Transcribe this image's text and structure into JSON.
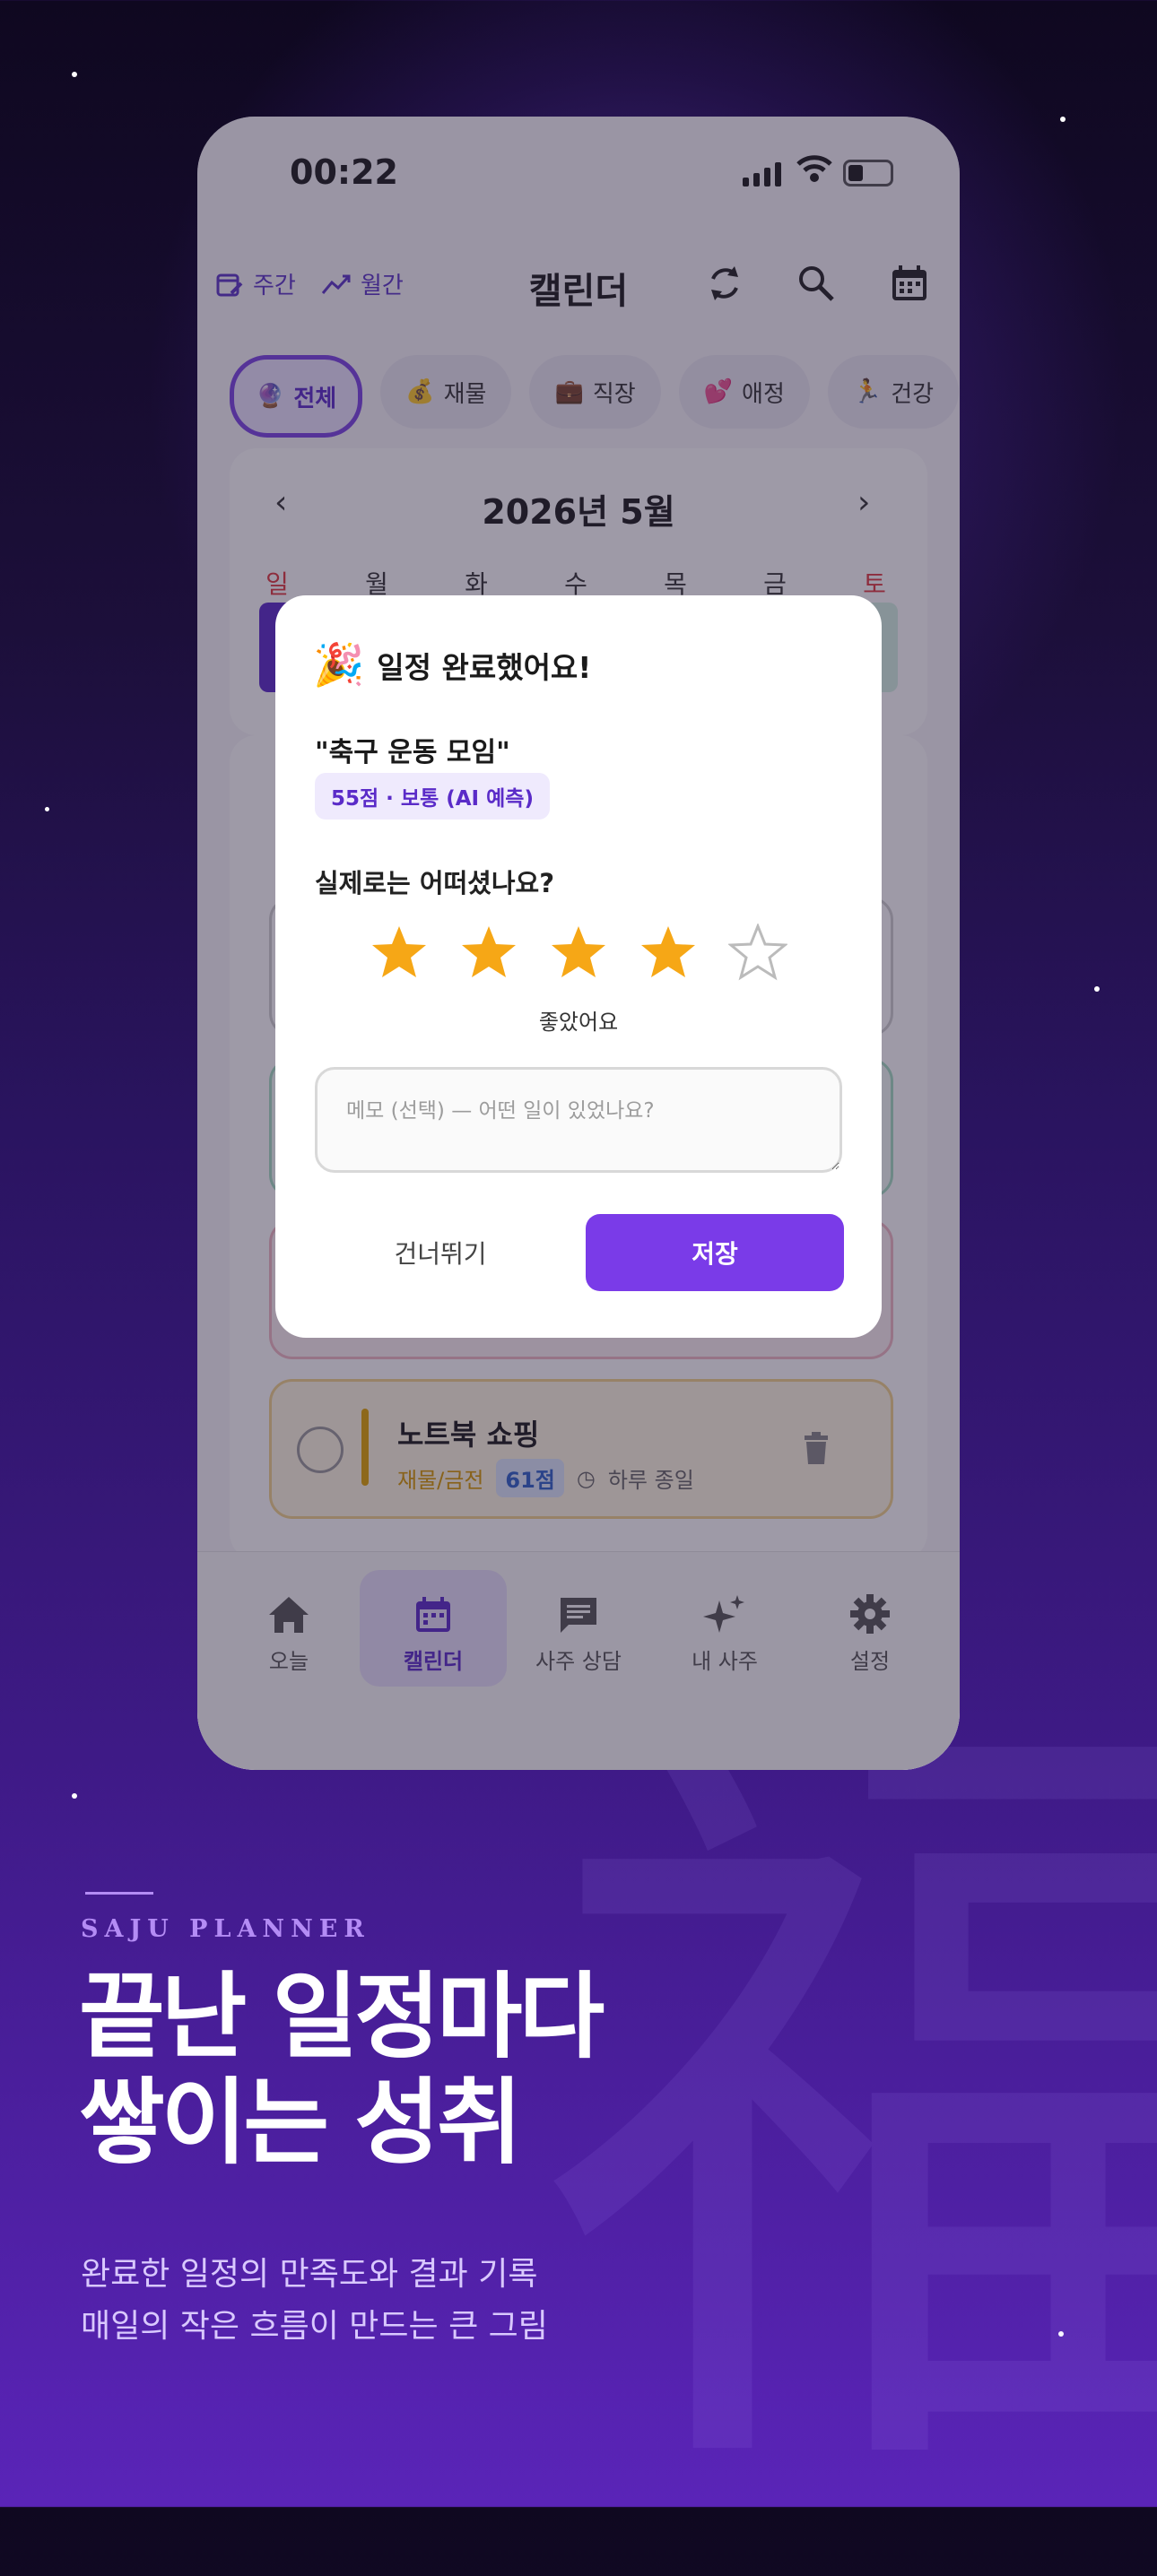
{
  "status_bar": {
    "time": "00:22"
  },
  "app_bar": {
    "weekly": "주간",
    "monthly": "월간",
    "title": "캘린더"
  },
  "chips": [
    {
      "icon": "🔮",
      "label": "전체",
      "selected": true
    },
    {
      "icon": "💰",
      "label": "재물"
    },
    {
      "icon": "💼",
      "label": "직장"
    },
    {
      "icon": "💕",
      "label": "애정"
    },
    {
      "icon": "🏃",
      "label": "건강"
    }
  ],
  "calendar": {
    "month": "2026년 5월",
    "weekdays": [
      "일",
      "월",
      "화",
      "수",
      "목",
      "금",
      "토"
    ]
  },
  "event": {
    "title": "노트북 쇼핑",
    "category": "재물/금전",
    "score": "61점",
    "time": "하루 종일"
  },
  "nav": [
    "오늘",
    "캘린더",
    "사주 상담",
    "내 사주",
    "설정"
  ],
  "modal": {
    "emoji": "🎉",
    "title": "일정 완료했어요!",
    "event_name": "\"축구 운동 모임\"",
    "badge": "55점 · 보통 (AI 예측)",
    "question": "실제로는 어떠셨나요?",
    "rating": 4,
    "rating_max": 5,
    "rating_label": "좋았어요",
    "memo_placeholder": "메모 (선택) — 어떤 일이 있었나요?",
    "skip": "건너뛰기",
    "save": "저장"
  },
  "promo": {
    "tagline": "SAJU PLANNER",
    "headline_1": "끝난 일정마다",
    "headline_2": "쌓이는 성취",
    "sub_1": "완료한 일정의 만족도와 결과 기록",
    "sub_2": "매일의 작은 흐름이 만드는 큰 그림",
    "watermark": "福"
  },
  "colors": {
    "accent": "#7a3be8",
    "star": "#f6a716",
    "weekend": "#e0393e"
  }
}
